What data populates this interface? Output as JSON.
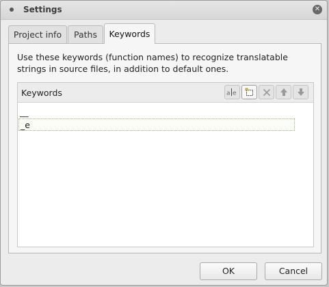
{
  "window": {
    "title": "Settings",
    "close_icon": "close-icon"
  },
  "tabs": [
    {
      "label": "Project info",
      "active": false
    },
    {
      "label": "Paths",
      "active": false
    },
    {
      "label": "Keywords",
      "active": true
    }
  ],
  "keywords_tab": {
    "description": "Use these keywords (function names) to recognize translatable strings in source files, in addition to default ones.",
    "list_header": "Keywords",
    "toolbar": [
      {
        "name": "rename-keyword-button",
        "icon": "rename-icon"
      },
      {
        "name": "add-keyword-button",
        "icon": "new-item-icon"
      },
      {
        "name": "delete-keyword-button",
        "icon": "delete-icon"
      },
      {
        "name": "move-up-button",
        "icon": "arrow-up-icon"
      },
      {
        "name": "move-down-button",
        "icon": "arrow-down-icon"
      }
    ],
    "items": [
      "__",
      "_e"
    ],
    "selected_index": 1
  },
  "buttons": {
    "ok": "OK",
    "cancel": "Cancel"
  },
  "colors": {
    "selection_border": "#9bb57d",
    "window_bg": "#ececec"
  }
}
